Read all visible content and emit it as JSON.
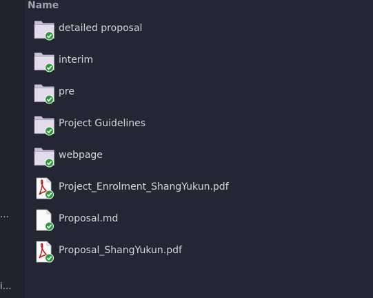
{
  "sidebar": {
    "frag_1": "…",
    "frag_2": "i…"
  },
  "list": {
    "header": "Name",
    "items": [
      {
        "name": "detailed proposal",
        "type": "folder",
        "status": "synced"
      },
      {
        "name": "interim",
        "type": "folder",
        "status": "synced"
      },
      {
        "name": "pre",
        "type": "folder",
        "status": "synced"
      },
      {
        "name": "Project Guidelines",
        "type": "folder",
        "status": "synced"
      },
      {
        "name": "webpage",
        "type": "folder",
        "status": "synced"
      },
      {
        "name": "Project_Enrolment_ShangYukun.pdf",
        "type": "pdf",
        "status": "synced"
      },
      {
        "name": "Proposal.md",
        "type": "text",
        "status": "synced"
      },
      {
        "name": "Proposal_ShangYukun.pdf",
        "type": "pdf",
        "status": "synced"
      }
    ]
  },
  "colors": {
    "background": "#242733",
    "sync_badge": "#2e9a3e",
    "folder": "#ddd7e6",
    "pdf_accent": "#c01818"
  }
}
